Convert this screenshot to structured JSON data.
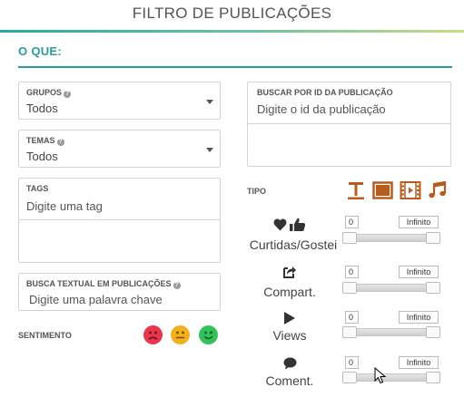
{
  "header": {
    "title": "FILTRO DE PUBLICAÇÕES"
  },
  "section": {
    "title": "O QUE:"
  },
  "filters": {
    "grupos": {
      "label": "GRUPOS",
      "value": "Todos"
    },
    "temas": {
      "label": "TEMAS",
      "value": "Todos"
    },
    "tags": {
      "label": "TAGS",
      "placeholder": "Digite uma tag"
    },
    "busca_textual": {
      "label": "BUSCA TEXTUAL EM PUBLICAÇÕES",
      "placeholder": "Digite uma palavra chave"
    },
    "buscar_id": {
      "label": "BUSCAR POR ID DA PUBLICAÇÃO",
      "placeholder": "Digite o id da publicação"
    },
    "help_glyph": "?"
  },
  "sentimento": {
    "label": "SENTIMENTO",
    "options": [
      {
        "name": "negative",
        "color": "#e8374d"
      },
      {
        "name": "neutral",
        "color": "#f2b01e"
      },
      {
        "name": "positive",
        "color": "#35c15a"
      }
    ]
  },
  "tipo": {
    "label": "TIPO",
    "icon_color": "#b85c1e",
    "icons": [
      "text-type-icon",
      "image-type-icon",
      "video-type-icon",
      "music-type-icon"
    ]
  },
  "metrics": [
    {
      "name": "curtidas",
      "label": "Curtidas/Gostei",
      "icon": "heart-thumbs-up-icon",
      "min": "0",
      "max": "Infinito"
    },
    {
      "name": "compart",
      "label": "Compart.",
      "icon": "share-icon",
      "min": "0",
      "max": "Infinito"
    },
    {
      "name": "views",
      "label": "Views",
      "icon": "play-icon",
      "min": "0",
      "max": "Infinito"
    },
    {
      "name": "coment",
      "label": "Coment.",
      "icon": "comment-icon",
      "min": "0",
      "max": "Infinito"
    }
  ]
}
